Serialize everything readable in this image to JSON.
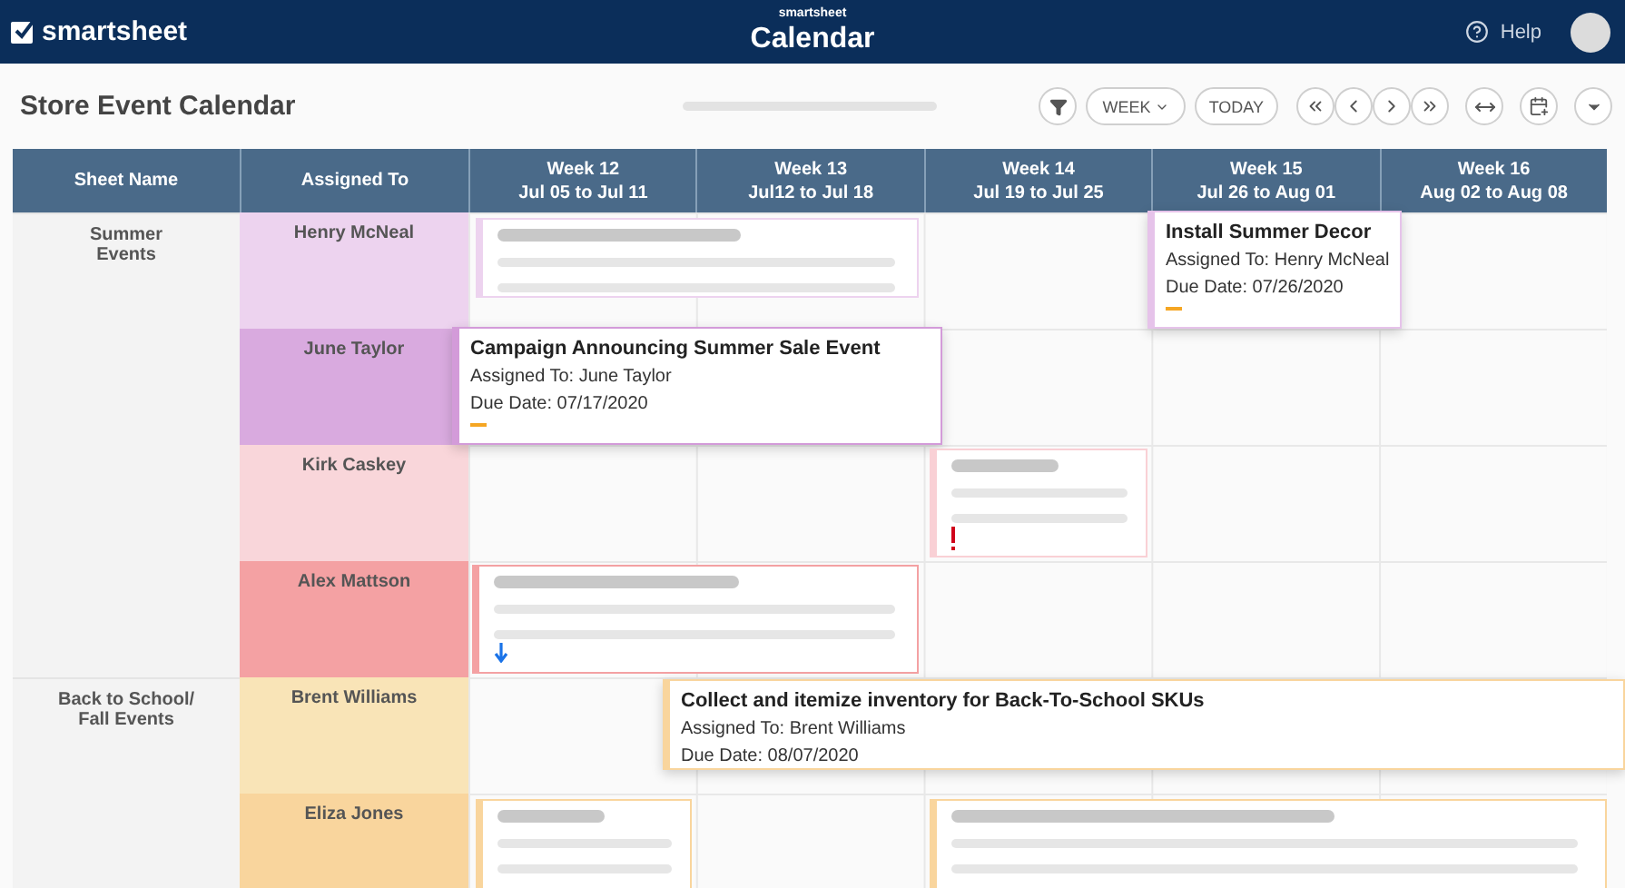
{
  "app_bar": {
    "logo_text": "smartsheet",
    "brand_small": "smartsheet",
    "title": "Calendar",
    "help_label": "Help"
  },
  "toolbar": {
    "title": "Store Event Calendar",
    "view_label": "WEEK",
    "today_label": "TODAY"
  },
  "table": {
    "columns": [
      {
        "label": "Sheet Name"
      },
      {
        "label": "Assigned To"
      },
      {
        "label": "Week 12",
        "range": "Jul 05 to Jul 11"
      },
      {
        "label": "Week 13",
        "range": "Jul12 to Jul 18"
      },
      {
        "label": "Week 14",
        "range": "Jul 19 to Jul 25"
      },
      {
        "label": "Week 15",
        "range": "Jul 26 to Aug 01"
      },
      {
        "label": "Week 16",
        "range": "Aug 02 to Aug 08"
      }
    ],
    "groups": [
      {
        "name": "Summer\nEvents",
        "people": [
          {
            "name": "Henry McNeal",
            "color": "#edd3ef"
          },
          {
            "name": "June Taylor",
            "color": "#d9aadf"
          },
          {
            "name": "Kirk Caskey",
            "color": "#f9d6da"
          },
          {
            "name": "Alex Mattson",
            "color": "#f4a1a3"
          }
        ]
      },
      {
        "name": "Back to School/\nFall Events",
        "people": [
          {
            "name": "Brent Williams",
            "color": "#f9e4b7"
          },
          {
            "name": "Eliza Jones",
            "color": "#f9d59d"
          }
        ]
      }
    ]
  },
  "events": [
    {
      "kind": "placeholder",
      "color": "#edd3ef"
    },
    {
      "kind": "detail",
      "color": "#e6c3ea",
      "title": "Install Summer Decor",
      "assigned": "Assigned To: Henry McNeal",
      "due": "Due Date: 07/26/2020",
      "marker": {
        "kind": "dash"
      }
    },
    {
      "kind": "detail",
      "color": "#d39bd9",
      "title": "Campaign Announcing Summer Sale Event",
      "assigned": "Assigned To: June Taylor",
      "due": "Due Date: 07/17/2020",
      "marker": {
        "kind": "dash"
      }
    },
    {
      "kind": "placeholder",
      "color": "#f9d0d5",
      "marker": {
        "kind": "exclamation"
      }
    },
    {
      "kind": "placeholder",
      "color": "#f4a1a3",
      "marker": {
        "kind": "down-arrow"
      }
    },
    {
      "kind": "detail",
      "color": "#f9d59d",
      "title": "Collect and itemize inventory for Back-To-School SKUs",
      "assigned": "Assigned To: Brent Williams",
      "due": "Due Date: 08/07/2020"
    },
    {
      "kind": "placeholder",
      "color": "#f9d59d"
    },
    {
      "kind": "placeholder",
      "color": "#f9d59d"
    }
  ]
}
